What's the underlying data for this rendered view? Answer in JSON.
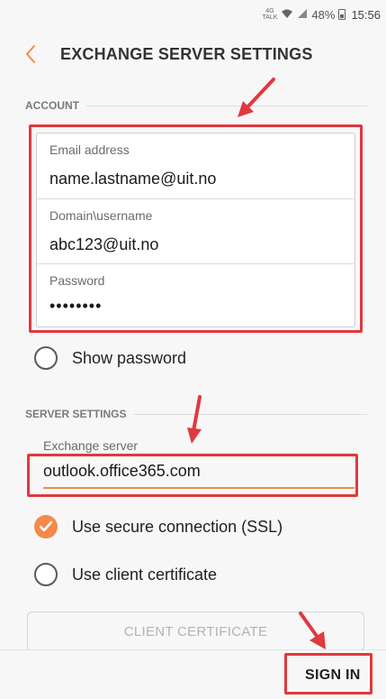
{
  "status_bar": {
    "network_top": "4G",
    "network_bottom": "TALK",
    "battery": "48%",
    "time": "15:56"
  },
  "header": {
    "title": "EXCHANGE SERVER SETTINGS",
    "back_icon": "chevron-left-icon"
  },
  "account": {
    "section_label": "ACCOUNT",
    "email_label": "Email address",
    "email_value": "name.lastname@uit.no",
    "domain_label": "Domain\\username",
    "domain_value": "abc123@uit.no",
    "password_label": "Password",
    "password_value": "••••••••",
    "show_password_label": "Show password",
    "show_password_checked": false
  },
  "server": {
    "section_label": "SERVER SETTINGS",
    "exchange_label": "Exchange server",
    "exchange_value": "outlook.office365.com",
    "ssl_label": "Use secure connection (SSL)",
    "ssl_checked": true,
    "client_cert_label": "Use client certificate",
    "client_cert_checked": false,
    "client_cert_button": "CLIENT CERTIFICATE"
  },
  "footer": {
    "sign_in_label": "SIGN IN"
  },
  "colors": {
    "accent": "#f5894a",
    "annotation": "#e0393f"
  }
}
